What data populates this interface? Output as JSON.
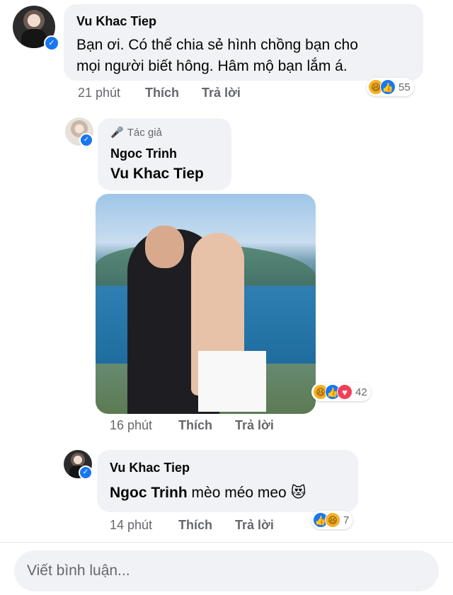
{
  "comments": [
    {
      "author": "Vu Khac Tiep",
      "line1": "Bạn ơi. Có thể chia sẻ hình chồng bạn cho",
      "line2": "mọi người biết hông. Hâm mộ bạn lắm á.",
      "time": "21 phút",
      "like_label": "Thích",
      "reply_label": "Trả lời",
      "reaction_count": "55",
      "reactions": [
        "haha",
        "like"
      ]
    },
    {
      "author_badge": "Tác giả",
      "author": "Ngoc Trinh",
      "mention": "Vu Khac Tiep",
      "time": "16 phút",
      "like_label": "Thích",
      "reply_label": "Trả lời",
      "reaction_count": "42",
      "reactions": [
        "haha",
        "like",
        "love"
      ]
    },
    {
      "author": "Vu Khac Tiep",
      "mention": "Ngoc Trinh",
      "text": "mèo méo meo",
      "emoji": "😻",
      "time": "14 phút",
      "like_label": "Thích",
      "reply_label": "Trả lời",
      "reaction_count": "7",
      "reactions": [
        "like",
        "haha"
      ]
    }
  ],
  "composer": {
    "placeholder": "Viết bình luận..."
  },
  "colors": {
    "bubble": "#f0f2f5",
    "meta": "#65676b",
    "verified": "#1877f2",
    "like": "#1877f2",
    "love": "#f33e58",
    "haha": "#f7b125"
  }
}
